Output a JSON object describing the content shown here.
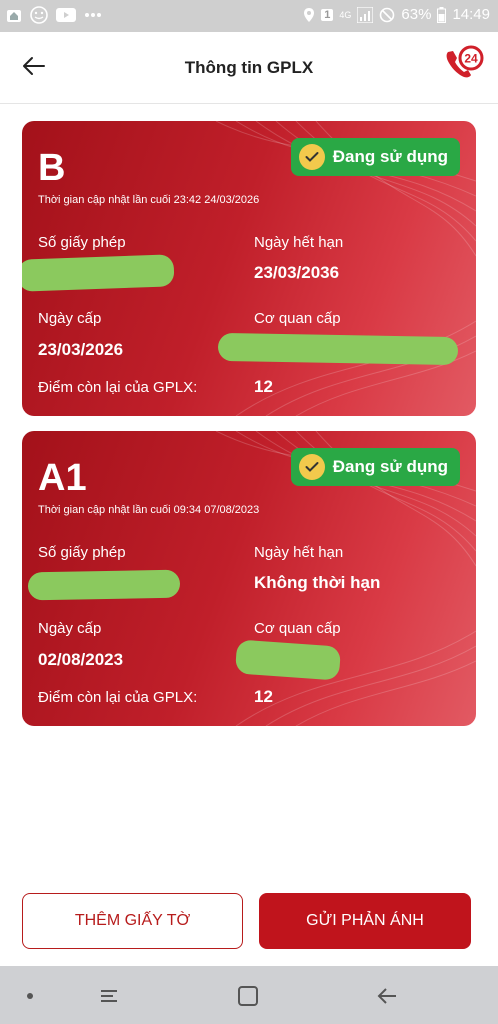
{
  "status_bar": {
    "network": "4G",
    "battery": "63%",
    "time": "14:49",
    "notif_count": "1"
  },
  "header": {
    "title": "Thông tin GPLX",
    "hotline_label": "24"
  },
  "licenses": [
    {
      "class": "B",
      "status": "Đang sử dụng",
      "updated": "Thời gian cập nhật lần cuối 23:42 24/03/2026",
      "license_no_label": "Số giấy phép",
      "expiry_label": "Ngày hết hạn",
      "expiry_value": "23/03/2036",
      "issue_date_label": "Ngày cấp",
      "issue_date_value": "23/03/2026",
      "issuer_label": "Cơ quan cấp",
      "points_label": "Điểm còn lại của GPLX:",
      "points_value": "12"
    },
    {
      "class": "A1",
      "status": "Đang sử dụng",
      "updated": "Thời gian cập nhật lần cuối 09:34 07/08/2023",
      "license_no_label": "Số giấy phép",
      "expiry_label": "Ngày hết hạn",
      "expiry_value": "Không thời hạn",
      "issue_date_label": "Ngày cấp",
      "issue_date_value": "02/08/2023",
      "issuer_label": "Cơ quan cấp",
      "points_label": "Điểm còn lại của GPLX:",
      "points_value": "12"
    }
  ],
  "actions": {
    "add_doc": "THÊM GIẤY TỜ",
    "feedback": "GỬI PHẢN ÁNH"
  },
  "colors": {
    "brand_red": "#c0141c",
    "badge_green": "#2aa845",
    "check_yellow": "#f2c94c",
    "redaction_green": "#8bc95e"
  }
}
